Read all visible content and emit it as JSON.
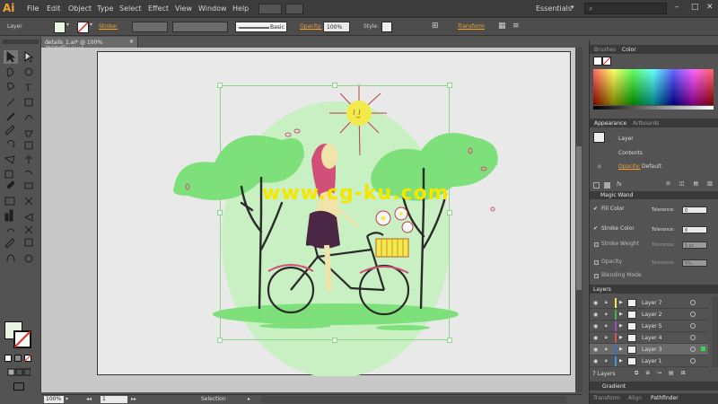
{
  "app": {
    "logo": "Ai"
  },
  "menus": [
    "File",
    "Edit",
    "Object",
    "Type",
    "Select",
    "Effect",
    "View",
    "Window",
    "Help"
  ],
  "workspace": {
    "label": "Essentials"
  },
  "control": {
    "selection_type": "Layer",
    "stroke_label": "Stroke:",
    "brush": "Basic",
    "opacity_label": "Opacity:",
    "opacity_value": "100%",
    "style_label": "Style:",
    "transform_label": "Transform"
  },
  "document": {
    "tab_title": "details_1.ai* @ 100% (RGB/Preview)"
  },
  "status": {
    "zoom": "100%",
    "artboard": "1",
    "tool": "Selection"
  },
  "watermark": "www.cg-ku.com",
  "panels": {
    "color_tabs": {
      "brushes": "Brushes",
      "color": "Color"
    },
    "appearance_tabs": {
      "appearance": "Appearance",
      "artboards": "Artboards"
    },
    "appearance": {
      "target": "Layer",
      "contents": "Contents",
      "opacity_label": "Opacity:",
      "opacity_value": "Default",
      "fx": "fx"
    },
    "magic_wand": {
      "title": "Magic Wand",
      "fill_color": "Fill Color",
      "stroke_color": "Stroke Color",
      "stroke_weight": "Stroke Weight",
      "opacity": "Opacity",
      "blending": "Blending Mode",
      "tolerance_label": "Tolerance:",
      "fill_tol": "0",
      "stroke_tol": "0",
      "weight_tol": "5 pt",
      "opacity_tol": "5%"
    },
    "layers": {
      "title": "Layers",
      "items": [
        "Layer 7",
        "Layer 2",
        "Layer 5",
        "Layer 4",
        "Layer 3",
        "Layer 1"
      ],
      "count": "7 Layers"
    },
    "gradient_title": "Gradient",
    "bottom_tabs": {
      "transform": "Transform",
      "align": "Align",
      "pathfinder": "Pathfinder"
    }
  },
  "colors": {
    "accent": "#f4a233",
    "art_green": "#7de07a",
    "art_pale": "#c9f0c2",
    "sun": "#f2ea4b",
    "hair": "#d1507a"
  }
}
